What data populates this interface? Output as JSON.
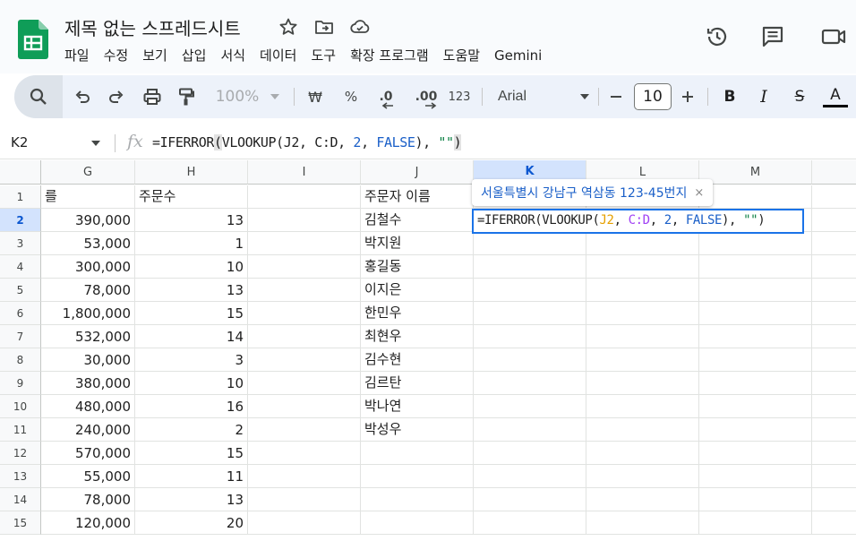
{
  "header": {
    "title": "제목 없는 스프레드시트",
    "menu": [
      "파일",
      "수정",
      "보기",
      "삽입",
      "서식",
      "데이터",
      "도구",
      "확장 프로그램",
      "도움말",
      "Gemini"
    ]
  },
  "toolbar": {
    "zoom": "100%",
    "currency": "₩",
    "percent": "%",
    "decrease_decimal": ".0",
    "increase_decimal": ".00",
    "number_format": "123",
    "font": "Arial",
    "font_size": "10",
    "bold": "B",
    "italic": "I",
    "strike": "S",
    "text_color": "A"
  },
  "formula_bar": {
    "cell_ref": "K2",
    "fx": "fx"
  },
  "formula": {
    "p1": "=IFERROR",
    "open": "(",
    "p2": "VLOOKUP(J2, C:D, ",
    "num": "2",
    "comma": ", ",
    "kw": "FALSE",
    "p3": "), ",
    "str": "\"\"",
    "close": ")"
  },
  "editor": {
    "p1": "=IFERROR(VLOOKUP(",
    "ref1": "J2",
    "sep1": ", ",
    "ref2": "C:D",
    "sep2": ", ",
    "num": "2",
    "sep3": ", ",
    "kw": "FALSE",
    "p2": "), ",
    "str": "\"\"",
    "close": ")"
  },
  "tooltip": {
    "text": "서울특별시 강남구 역삼동 123-45번지",
    "close": "×"
  },
  "columns": [
    "G",
    "H",
    "I",
    "J",
    "K",
    "L",
    "M"
  ],
  "rows": [
    "1",
    "2",
    "3",
    "4",
    "5",
    "6",
    "7",
    "8",
    "9",
    "10",
    "11",
    "12",
    "13",
    "14",
    "15"
  ],
  "row1": {
    "g": "를",
    "h": "주문수",
    "j": "주문자 이름"
  },
  "colG": [
    "390,000",
    "53,000",
    "300,000",
    "78,000",
    "1,800,000",
    "532,000",
    "30,000",
    "380,000",
    "480,000",
    "240,000",
    "570,000",
    "55,000",
    "78,000",
    "120,000"
  ],
  "colH": [
    "13",
    "1",
    "10",
    "13",
    "15",
    "14",
    "3",
    "10",
    "16",
    "2",
    "15",
    "11",
    "13",
    "20"
  ],
  "colJ": [
    "김철수",
    "박지원",
    "홍길동",
    "이지은",
    "한민우",
    "최현우",
    "김수현",
    "김르탄",
    "박나연",
    "박성우"
  ]
}
